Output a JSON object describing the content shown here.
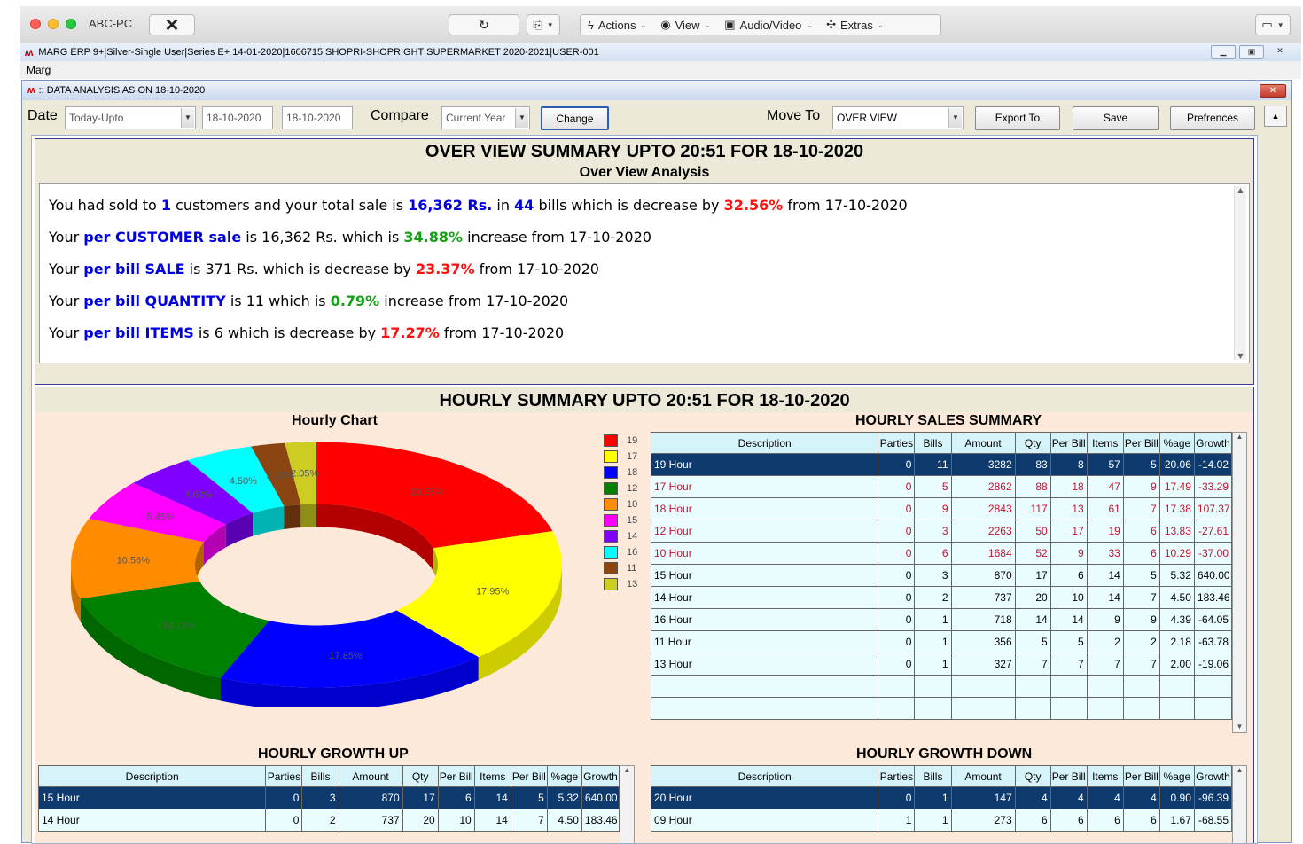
{
  "viewer": {
    "pc_name": "ABC-PC",
    "actions_label": "Actions",
    "view_label": "View",
    "audio_video_label": "Audio/Video",
    "extras_label": "Extras"
  },
  "app": {
    "title": "MARG ERP 9+|Silver-Single User|Series E+ 14-01-2020|1606715|SHOPRI-SHOPRIGHT SUPERMARKET 2020-2021|USER-001",
    "menu": "Marg"
  },
  "window": {
    "title": ":: DATA ANALYSIS AS ON 18-10-2020"
  },
  "toolbar": {
    "date_label": "Date",
    "date_mode": "Today-Upto",
    "date_from": "18-10-2020",
    "date_to": "18-10-2020",
    "compare_label": "Compare",
    "compare_mode": "Current Year",
    "change_label": "Change",
    "move_to_label": "Move To",
    "move_to_value": "OVER VIEW",
    "export_label": "Export To",
    "save_label": "Save",
    "prefs_label": "Prefrences"
  },
  "overview": {
    "title": "OVER VIEW SUMMARY UPTO 20:51 FOR 18-10-2020",
    "subtitle": "Over View Analysis",
    "l1": {
      "a": "You had sold to ",
      "b": "1",
      "c": " customers and your total sale is ",
      "d": "16,362 Rs.",
      "e": " in ",
      "f": "44",
      "g": " bills which is decrease by ",
      "h": "32.56%",
      "i": " from 17-10-2020"
    },
    "l2": {
      "a": "Your ",
      "b": "per CUSTOMER sale",
      "c": " is 16,362 Rs. which is ",
      "d": "34.88%",
      "e": " increase from 17-10-2020"
    },
    "l3": {
      "a": "Your ",
      "b": "per bill SALE",
      "c": " is 371 Rs. which is decrease by ",
      "d": "23.37%",
      "e": " from 17-10-2020"
    },
    "l4": {
      "a": "Your ",
      "b": "per bill QUANTITY",
      "c": " is 11 which is ",
      "d": "0.79%",
      "e": " increase from 17-10-2020"
    },
    "l5": {
      "a": "Your ",
      "b": "per bill ITEMS",
      "c": " is 6 which is decrease by ",
      "d": "17.27%",
      "e": " from 17-10-2020"
    }
  },
  "hourly": {
    "title": "HOURLY SUMMARY UPTO 20:51 FOR 18-10-2020",
    "chart_title": "Hourly Chart",
    "sales_title": "HOURLY SALES SUMMARY",
    "growth_up_title": "HOURLY GROWTH UP",
    "growth_down_title": "HOURLY GROWTH DOWN",
    "columns": [
      "Description",
      "Parties",
      "Bills",
      "Amount",
      "Qty",
      "Per Bill",
      "Items",
      "Per Bill",
      "%age",
      "Growth"
    ],
    "sales_rows": [
      [
        "19 Hour",
        "0",
        "11",
        "3282",
        "83",
        "8",
        "57",
        "5",
        "20.06",
        "-14.02"
      ],
      [
        "17 Hour",
        "0",
        "5",
        "2862",
        "88",
        "18",
        "47",
        "9",
        "17.49",
        "-33.29"
      ],
      [
        "18 Hour",
        "0",
        "9",
        "2843",
        "117",
        "13",
        "61",
        "7",
        "17.38",
        "107.37"
      ],
      [
        "12 Hour",
        "0",
        "3",
        "2263",
        "50",
        "17",
        "19",
        "6",
        "13.83",
        "-27.61"
      ],
      [
        "10 Hour",
        "0",
        "6",
        "1684",
        "52",
        "9",
        "33",
        "6",
        "10.29",
        "-37.00"
      ],
      [
        "15 Hour",
        "0",
        "3",
        "870",
        "17",
        "6",
        "14",
        "5",
        "5.32",
        "640.00"
      ],
      [
        "14 Hour",
        "0",
        "2",
        "737",
        "20",
        "10",
        "14",
        "7",
        "4.50",
        "183.46"
      ],
      [
        "16 Hour",
        "0",
        "1",
        "718",
        "14",
        "14",
        "9",
        "9",
        "4.39",
        "-64.05"
      ],
      [
        "11 Hour",
        "0",
        "1",
        "356",
        "5",
        "5",
        "2",
        "2",
        "2.18",
        "-63.78"
      ],
      [
        "13 Hour",
        "0",
        "1",
        "327",
        "7",
        "7",
        "7",
        "7",
        "2.00",
        "-19.06"
      ]
    ],
    "growth_up_rows": [
      [
        "15 Hour",
        "0",
        "3",
        "870",
        "17",
        "6",
        "14",
        "5",
        "5.32",
        "640.00"
      ],
      [
        "14 Hour",
        "0",
        "2",
        "737",
        "20",
        "10",
        "14",
        "7",
        "4.50",
        "183.46"
      ]
    ],
    "growth_down_rows": [
      [
        "20 Hour",
        "0",
        "1",
        "147",
        "4",
        "4",
        "4",
        "4",
        "0.90",
        "-96.39"
      ],
      [
        "09 Hour",
        "1",
        "1",
        "273",
        "6",
        "6",
        "6",
        "6",
        "1.67",
        "-68.55"
      ]
    ]
  },
  "chart_data": {
    "type": "pie",
    "title": "Hourly Chart",
    "categories": [
      "19",
      "17",
      "18",
      "12",
      "10",
      "15",
      "14",
      "16",
      "11",
      "13"
    ],
    "values": [
      20.06,
      17.49,
      17.38,
      13.83,
      10.29,
      5.32,
      4.5,
      4.39,
      2.18,
      2.0
    ],
    "labels": [
      "20.58%",
      "17.95%",
      "17.85%",
      "14.19%",
      "10.56%",
      "5.45%",
      "4.62%",
      "4.50%",
      "2.23%",
      "2.05%"
    ],
    "colors": [
      "#ff0000",
      "#ffff00",
      "#0000ff",
      "#008000",
      "#ff8c00",
      "#ff00ff",
      "#8000ff",
      "#00ffff",
      "#8b4513",
      "#cccc22"
    ],
    "legend_position": "right"
  }
}
